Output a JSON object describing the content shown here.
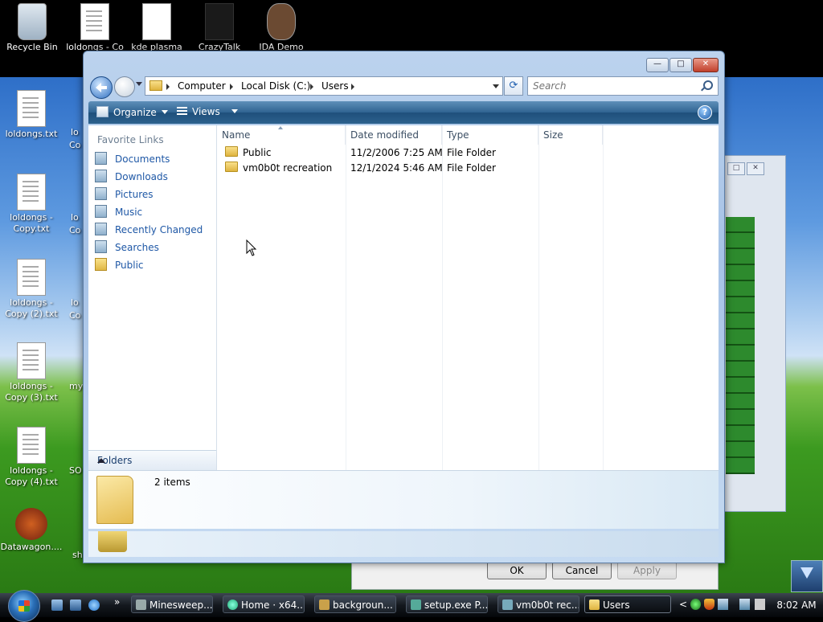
{
  "desktop": {
    "icons": [
      {
        "label": "Recycle Bin"
      },
      {
        "label": "loldongs - Co"
      },
      {
        "label": "kde plasma"
      },
      {
        "label": "CrazyTalk"
      },
      {
        "label": "IDA Demo"
      },
      {
        "label": "loldongs.txt"
      },
      {
        "label": "loldongs - Copy.txt"
      },
      {
        "label": "loldongs - Copy (2).txt"
      },
      {
        "label": "loldongs - Copy (3).txt"
      },
      {
        "label": "loldongs - Copy (4).txt"
      },
      {
        "label": "Datawagon...."
      }
    ],
    "partial_labels": [
      "lo",
      "Co",
      "lo",
      "Co",
      "lo",
      "Co",
      "my",
      "SO",
      "sh"
    ]
  },
  "explorer": {
    "caption_buttons": {
      "minimize": "—",
      "maximize": "□",
      "close": "✕"
    },
    "breadcrumb": [
      "Computer",
      "Local Disk (C:)",
      "Users"
    ],
    "search_placeholder": "Search",
    "toolbar": {
      "organize": "Organize",
      "views": "Views",
      "help": "?"
    },
    "nav": {
      "header": "Favorite Links",
      "links": [
        "Documents",
        "Downloads",
        "Pictures",
        "Music",
        "Recently Changed",
        "Searches",
        "Public"
      ],
      "folders_label": "Folders"
    },
    "columns": [
      "Name",
      "Date modified",
      "Type",
      "Size"
    ],
    "rows": [
      {
        "name": "Public",
        "date": "11/2/2006 7:25 AM",
        "type": "File Folder",
        "size": ""
      },
      {
        "name": "vm0b0t recreation",
        "date": "12/1/2024 5:46 AM",
        "type": "File Folder",
        "size": ""
      }
    ],
    "details": {
      "count": "2 items"
    }
  },
  "background_dialog": {
    "ok": "OK",
    "cancel": "Cancel",
    "apply": "Apply"
  },
  "taskbar": {
    "tasks": [
      "Minesweep...",
      "Home · x64...",
      "backgroun...",
      "setup.exe P...",
      "vm0b0t rec...",
      "Users"
    ],
    "more": "»",
    "tray_chevron": "<",
    "clock": "8:02 AM"
  },
  "colors": {
    "link": "#1f58a6",
    "toolbar": "#2f6391",
    "accent": "#2a6fb8"
  }
}
